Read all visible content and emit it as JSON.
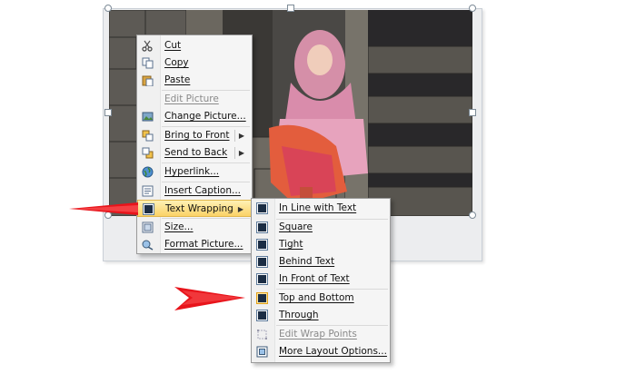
{
  "context_menu": {
    "items": [
      {
        "label": "Cut",
        "icon": "scissors-icon"
      },
      {
        "label": "Copy",
        "icon": "copy-icon"
      },
      {
        "label": "Paste",
        "icon": "paste-icon"
      },
      {
        "label": "Edit Picture",
        "icon": "none",
        "disabled": true
      },
      {
        "label": "Change Picture...",
        "icon": "change-picture-icon"
      },
      {
        "label": "Bring to Front",
        "icon": "bring-to-front-icon",
        "submenu": true
      },
      {
        "label": "Send to Back",
        "icon": "send-to-back-icon",
        "submenu": true
      },
      {
        "label": "Hyperlink...",
        "icon": "globe-link-icon"
      },
      {
        "label": "Insert Caption...",
        "icon": "insert-caption-icon"
      },
      {
        "label": "Text Wrapping",
        "icon": "text-wrapping-icon",
        "submenu": true,
        "highlighted": true
      },
      {
        "label": "Size...",
        "icon": "size-icon"
      },
      {
        "label": "Format Picture...",
        "icon": "format-picture-icon"
      }
    ],
    "submenu_arrow": "▶"
  },
  "wrap_submenu": {
    "items": [
      {
        "label": "In Line with Text",
        "icon": "inline-wrap-icon"
      },
      {
        "label": "Square",
        "icon": "square-wrap-icon"
      },
      {
        "label": "Tight",
        "icon": "tight-wrap-icon"
      },
      {
        "label": "Behind Text",
        "icon": "behind-text-icon"
      },
      {
        "label": "In Front of Text",
        "icon": "in-front-of-text-icon"
      },
      {
        "label": "Top and Bottom",
        "icon": "top-and-bottom-icon",
        "selected": true
      },
      {
        "label": "Through",
        "icon": "through-wrap-icon"
      },
      {
        "label": "Edit Wrap Points",
        "icon": "edit-wrap-points-icon",
        "disabled": true
      },
      {
        "label": "More Layout Options...",
        "icon": "layout-options-icon"
      }
    ]
  },
  "colors": {
    "highlight": "#fbd267",
    "annotation_arrow": "#e8141b",
    "menu_background": "#f5f5f5"
  }
}
